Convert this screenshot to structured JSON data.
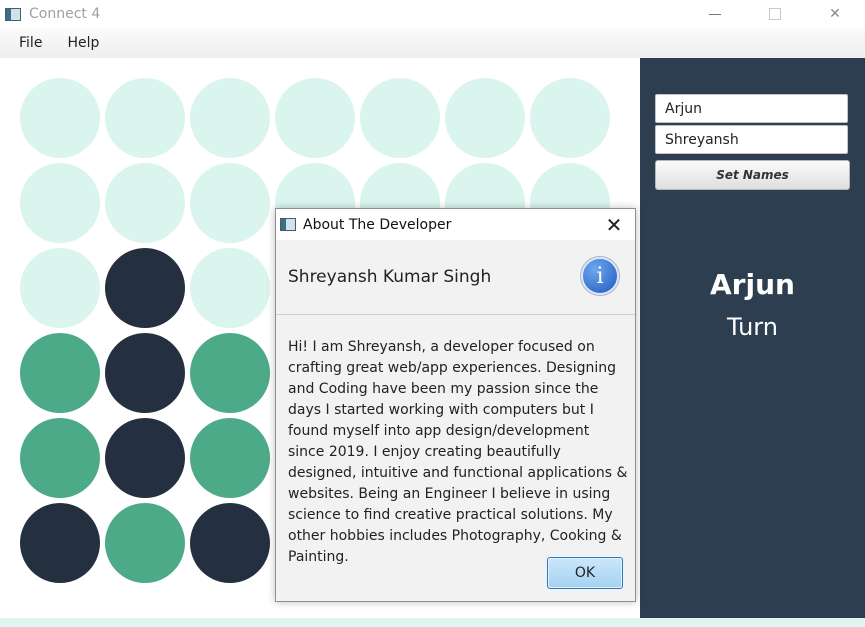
{
  "window": {
    "title": "Connect 4",
    "minimize_glyph": "—",
    "close_glyph": "✕"
  },
  "menu": {
    "items": [
      {
        "label": "File"
      },
      {
        "label": "Help"
      }
    ]
  },
  "board": {
    "columns": 7,
    "rows": 6,
    "colors": {
      "empty": "#daf4ee",
      "player1": "#4caa88",
      "player2": "#24303f"
    },
    "cells": [
      [
        "empty",
        "empty",
        "empty",
        "empty",
        "empty",
        "empty",
        "empty"
      ],
      [
        "empty",
        "empty",
        "empty",
        "empty",
        "empty",
        "empty",
        "empty"
      ],
      [
        "empty",
        "player2",
        "empty",
        "empty",
        "empty",
        "empty",
        "empty"
      ],
      [
        "player1",
        "player2",
        "player1",
        "empty",
        "empty",
        "empty",
        "empty"
      ],
      [
        "player1",
        "player2",
        "player1",
        "empty",
        "empty",
        "empty",
        "empty"
      ],
      [
        "player2",
        "player1",
        "player2",
        "empty",
        "empty",
        "empty",
        "empty"
      ]
    ]
  },
  "side_panel": {
    "player1_input": "Arjun",
    "player2_input": "Shreyansh",
    "set_names_label": "Set Names",
    "current_player": "Arjun",
    "turn_label": "Turn",
    "background": "#2c3e50"
  },
  "about_dialog": {
    "title": "About The Developer",
    "close_glyph": "✕",
    "header": "Shreyansh Kumar Singh",
    "info_icon": "info-icon",
    "info_glyph": "i",
    "body": "Hi! I am Shreyansh, a developer focused on crafting great web/app experiences. Designing and Coding have been my passion since the days I started working with computers but I found myself into app design/development since 2019. I enjoy creating beautifully designed, intuitive and functional applications & websites. Being an Engineer I believe in using science to find creative practical solutions. My other hobbies includes Photography, Cooking & Painting.",
    "ok_label": "OK"
  }
}
